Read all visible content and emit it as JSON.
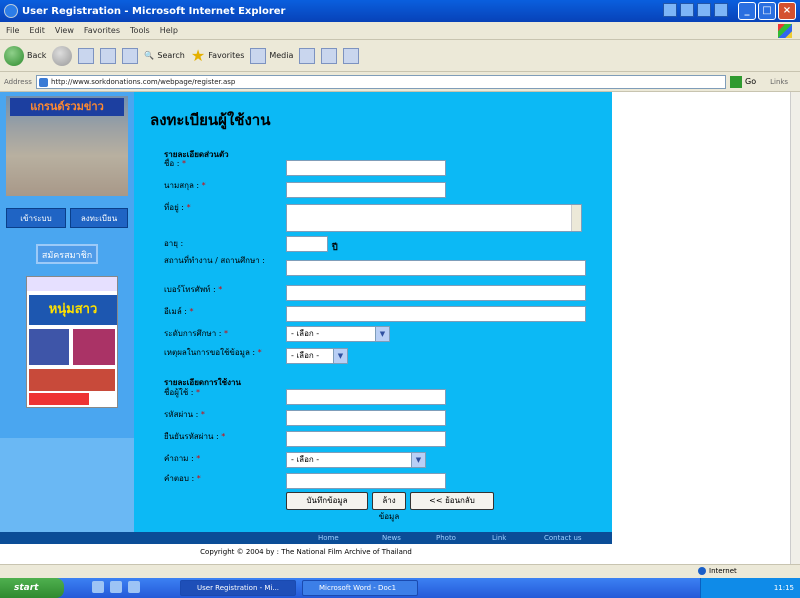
{
  "window": {
    "title": "User Registration - Microsoft Internet Explorer"
  },
  "menu": [
    "File",
    "Edit",
    "View",
    "Favorites",
    "Tools",
    "Help"
  ],
  "toolbar": {
    "back": "Back",
    "search": "Search",
    "favorites": "Favorites",
    "media": "Media"
  },
  "address": {
    "label": "Address",
    "url": "http://www.sorkdonations.com/webpage/register.asp",
    "go": "Go",
    "links": "Links"
  },
  "sidebar": {
    "logo_text": "แกรนด์รวมข่าว",
    "nav_buttons": [
      "เข้าระบบ",
      "ลงทะเบียน"
    ],
    "register_button": "สมัครสมาชิก",
    "magazine_title": "หนุ่มสาว"
  },
  "form": {
    "heading": "ลงทะเบียนผู้ใช้งาน",
    "section_personal": "รายละเอียดส่วนตัว",
    "fields": {
      "first_name": "ชื่อ :",
      "last_name": "นามสกุล :",
      "address": "ที่อยู่ :",
      "age": "อายุ :",
      "age_unit": "ปี",
      "workplace": "สถานที่ทำงาน / สถานศึกษา :",
      "phone": "เบอร์โทรศัพท์ :",
      "email": "อีเมล์ :",
      "education": "ระดับการศึกษา :",
      "reason": "เหตุผลในการขอใช้ข้อมูล :"
    },
    "required_mark": "*",
    "select_placeholder": "- เลือก -",
    "section_account": "รายละเอียดการใช้งาน",
    "account_fields": {
      "username": "ชื่อผู้ใช้ :",
      "password": "รหัสผ่าน :",
      "confirm_password": "ยืนยันรหัสผ่าน :",
      "question": "คำถาม :",
      "answer": "คำตอบ :"
    },
    "buttons": {
      "save": "บันทึกข้อมูล",
      "clear": "ล้างข้อมูล",
      "back": "<< ย้อนกลับ"
    }
  },
  "footer": {
    "nav": [
      "Home",
      "News",
      "Photo",
      "Link",
      "Contact us"
    ],
    "copyright": "Copyright © 2004 by : The National Film Archive of Thailand"
  },
  "status": {
    "zone": "Internet"
  },
  "taskbar": {
    "start": "start",
    "tasks": [
      "User Registration - Mi...",
      "Microsoft Word - Doc1"
    ],
    "clock": "11:15"
  }
}
